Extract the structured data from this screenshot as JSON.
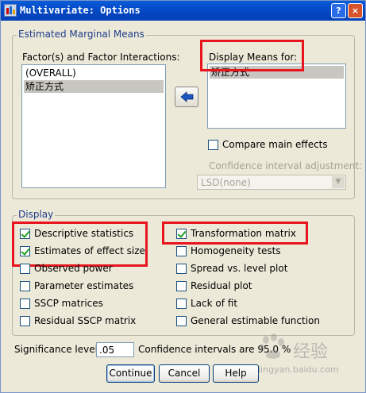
{
  "window": {
    "title": "Multivariate: Options",
    "help_button": "?",
    "close_button": "×"
  },
  "emm": {
    "legend": "Estimated Marginal Means",
    "factors_label": "Factor(s) and Factor Interactions:",
    "factors": [
      "(OVERALL)",
      "矫正方式"
    ],
    "display_label": "Display Means for:",
    "display_items": [
      "矫正方式"
    ],
    "compare_label": "Compare main effects",
    "compare_checked": false,
    "ci_adjustment_label": "Confidence interval adjustment:",
    "ci_adjustment_value": "LSD(none)"
  },
  "display": {
    "legend": "Display",
    "left": [
      {
        "label": "Descriptive statistics",
        "checked": true
      },
      {
        "label": "Estimates of effect size",
        "checked": true
      },
      {
        "label": "Observed power",
        "checked": false
      },
      {
        "label": "Parameter estimates",
        "checked": false
      },
      {
        "label": "SSCP matrices",
        "checked": false
      },
      {
        "label": "Residual SSCP matrix",
        "checked": false
      }
    ],
    "right": [
      {
        "label": "Transformation matrix",
        "checked": true
      },
      {
        "label": "Homogeneity tests",
        "checked": false
      },
      {
        "label": "Spread vs. level plot",
        "checked": false
      },
      {
        "label": "Residual plot",
        "checked": false
      },
      {
        "label": "Lack of fit",
        "checked": false
      },
      {
        "label": "General estimable function",
        "checked": false
      }
    ]
  },
  "significance": {
    "label": "Significance level:",
    "value": ".05",
    "ci_text": "Confidence intervals are 95.0 %"
  },
  "buttons": {
    "continue": "Continue",
    "cancel": "Cancel",
    "help": "Help"
  },
  "watermark": {
    "brand": "经验",
    "url": "jingyan.baidu.com"
  },
  "colors": {
    "highlight_box": "#e8141e",
    "titlebar": "#0345c0",
    "dialog_bg": "#ece9d8"
  }
}
